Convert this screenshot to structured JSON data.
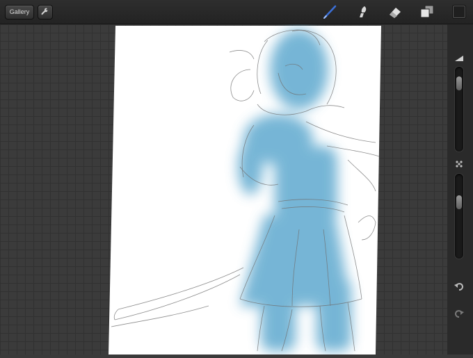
{
  "toolbar": {
    "gallery_label": "Gallery",
    "icons": [
      "wrench-icon",
      "brush-icon",
      "smudge-icon",
      "eraser-icon",
      "layers-icon",
      "color-swatch"
    ],
    "active_tool": "brush",
    "active_color": "#3b6fd6"
  },
  "sidebar": {
    "icons": [
      "brush-size-icon",
      "opacity-icon",
      "undo-icon",
      "redo-icon"
    ],
    "brush_size_level": 0.06,
    "opacity_level": 0.22
  },
  "canvas": {
    "background": "#ffffff",
    "paint_color": "#5fa9cf",
    "sketch_color": "#707070"
  }
}
